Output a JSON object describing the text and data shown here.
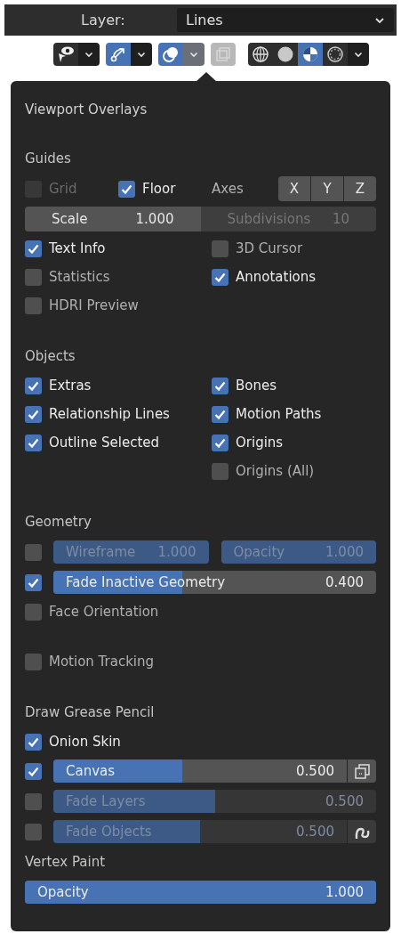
{
  "header": {
    "label": "Layer:",
    "dropdown": "Lines"
  },
  "toolbar": [
    {
      "buttons": [
        {
          "kind": "visibility",
          "selected": false
        },
        {
          "kind": "caret",
          "selected": false,
          "open": false
        }
      ]
    },
    {
      "buttons": [
        {
          "kind": "gizmo",
          "selected": true
        },
        {
          "kind": "caret",
          "selected": false,
          "open": false
        }
      ]
    },
    {
      "buttons": [
        {
          "kind": "overlays",
          "selected": true
        },
        {
          "kind": "caret",
          "selected": false,
          "open": true
        }
      ]
    },
    {
      "buttons": [
        {
          "kind": "xray",
          "disabled": true
        }
      ]
    },
    {
      "buttons": [
        {
          "kind": "wireframe",
          "selected": false
        },
        {
          "kind": "solid",
          "selected": false
        },
        {
          "kind": "material",
          "selected": true
        },
        {
          "kind": "rendered",
          "selected": false
        },
        {
          "kind": "caret",
          "selected": false,
          "open": false
        }
      ]
    }
  ],
  "panel": {
    "title": "Viewport Overlays",
    "sections": [
      {
        "title": "Guides",
        "rows": [
          {
            "kind": "items",
            "items": [
              {
                "kind": "check",
                "label": "Grid",
                "checked": false,
                "disabled": true
              },
              {
                "kind": "check",
                "label": "Floor",
                "checked": true,
                "disabled": false
              },
              {
                "kind": "label",
                "text": "Axes"
              },
              {
                "kind": "toggles",
                "items": [
                  {
                    "label": "X",
                    "selected": false
                  },
                  {
                    "label": "Y",
                    "selected": false
                  },
                  {
                    "label": "Z",
                    "selected": false
                  }
                ]
              }
            ]
          },
          {
            "kind": "fields",
            "items": [
              {
                "label": "Scale",
                "value": "1.000",
                "disabled": false
              },
              {
                "label": "Subdivisions",
                "value": "10",
                "disabled": true
              }
            ]
          },
          {
            "kind": "checks",
            "left": {
              "label": "Text Info",
              "checked": true
            },
            "right": {
              "label": "3D Cursor",
              "checked": false
            }
          },
          {
            "kind": "checks",
            "left": {
              "label": "Statistics",
              "checked": false
            },
            "right": {
              "label": "Annotations",
              "checked": true
            }
          },
          {
            "kind": "checks",
            "left": {
              "label": "HDRI Preview",
              "checked": false
            }
          }
        ]
      },
      {
        "title": "Objects",
        "rows": [
          {
            "kind": "checks",
            "left": {
              "label": "Extras",
              "checked": true
            },
            "right": {
              "label": "Bones",
              "checked": true
            }
          },
          {
            "kind": "checks",
            "left": {
              "label": "Relationship Lines",
              "checked": true
            },
            "right": {
              "label": "Motion Paths",
              "checked": true
            }
          },
          {
            "kind": "checks",
            "left": {
              "label": "Outline Selected",
              "checked": true
            },
            "right": {
              "label": "Origins",
              "checked": true
            }
          },
          {
            "kind": "checks",
            "right": {
              "label": "Origins (All)",
              "checked": false
            }
          }
        ]
      },
      {
        "title": "Geometry",
        "rows": [
          {
            "kind": "check_sliders",
            "checked": false,
            "sliders": [
              {
                "label": "Wireframe",
                "value": "1.000",
                "level": 1,
                "disabled": true
              },
              {
                "label": "Opacity",
                "value": "1.000",
                "level": 1,
                "disabled": true
              }
            ]
          },
          {
            "kind": "check_sliders",
            "checked": true,
            "sliders": [
              {
                "label": "Fade Inactive Geometry",
                "value": "0.400",
                "level": 0.4,
                "disabled": false
              }
            ]
          },
          {
            "kind": "checks",
            "left": {
              "label": "Face Orientation",
              "checked": false
            }
          }
        ]
      },
      {
        "rows": [
          {
            "kind": "checks",
            "left": {
              "label": "Motion Tracking",
              "checked": false
            }
          }
        ]
      },
      {
        "title": "Draw Grease Pencil",
        "rows": [
          {
            "kind": "checks",
            "left": {
              "label": "Onion Skin",
              "checked": true
            }
          },
          {
            "kind": "check_sliders",
            "checked": true,
            "sliders": [
              {
                "label": "Canvas",
                "value": "0.500",
                "level": 0.44,
                "disabled": false,
                "kind": "stack"
              }
            ]
          },
          {
            "kind": "check_sliders",
            "checked": false,
            "sliders": [
              {
                "label": "Fade Layers",
                "value": "0.500",
                "level": 0.5,
                "disabled": true
              }
            ]
          },
          {
            "kind": "check_sliders",
            "checked": false,
            "sliders": [
              {
                "label": "Fade Objects",
                "value": "0.500",
                "level": 0.5,
                "disabled": true,
                "kind": "curve"
              }
            ]
          }
        ]
      },
      {
        "title": "Vertex Paint",
        "rows": [
          {
            "kind": "slider",
            "slider": {
              "label": "Opacity",
              "value": "1.000",
              "level": 1,
              "disabled": false
            }
          }
        ]
      }
    ]
  }
}
